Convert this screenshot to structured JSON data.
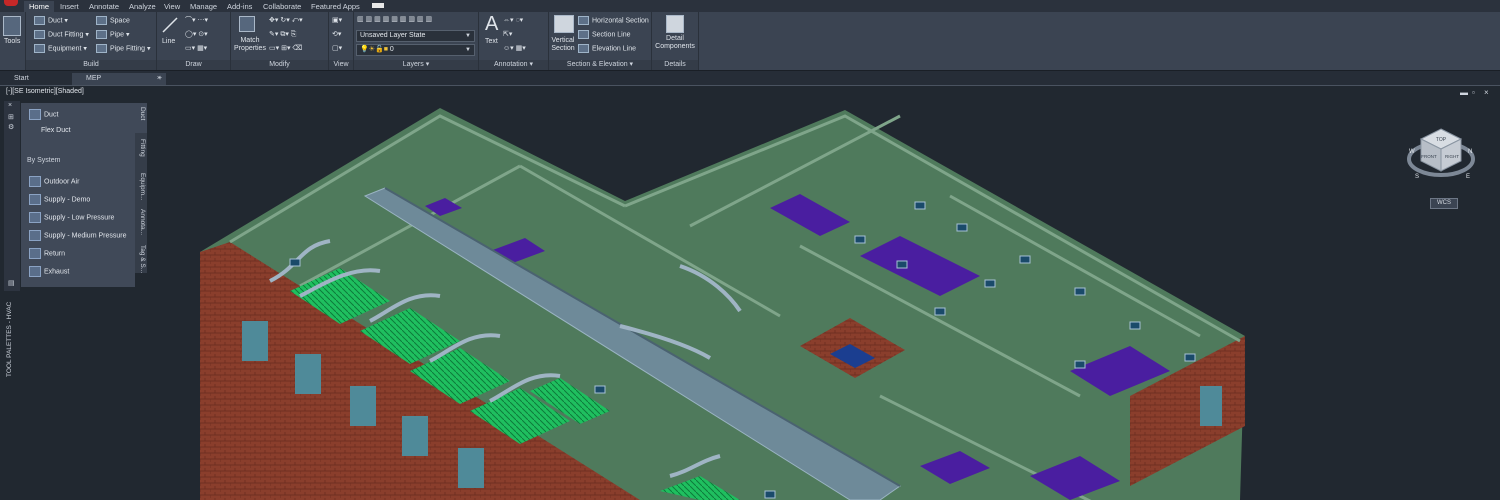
{
  "ribbon_tabs": [
    "Home",
    "Insert",
    "Annotate",
    "Analyze",
    "View",
    "Manage",
    "Add-ins",
    "Collaborate",
    "Featured Apps"
  ],
  "panels": {
    "tools": {
      "label": "Tools"
    },
    "build": {
      "title": "Build",
      "duct": "Duct",
      "duct_fitting": "Duct Fitting",
      "equipment": "Equipment",
      "space": "Space",
      "pipe": "Pipe",
      "pipe_fitting": "Pipe Fitting"
    },
    "draw": {
      "title": "Draw",
      "line": "Line"
    },
    "modify": {
      "title": "Modify",
      "match_properties": "Match Properties"
    },
    "view": {
      "title": "View"
    },
    "layers": {
      "title": "Layers",
      "layer_state": "Unsaved Layer State",
      "current_layer": "0"
    },
    "annotation": {
      "title": "Annotation",
      "text": "Text"
    },
    "section": {
      "title": "Section & Elevation",
      "vertical_section": "Vertical Section",
      "horizontal_section": "Horizontal Section",
      "section_line": "Section Line",
      "elevation_line": "Elevation Line"
    },
    "details": {
      "title": "Details",
      "detail_components": "Detail Components"
    }
  },
  "doc_tabs": [
    "Start",
    "MEP"
  ],
  "viewport_label": "[-][SE Isometric][Shaded]",
  "palette": {
    "title": "TOOL PALETTES - HVAC",
    "items_top": [
      "Duct",
      "Flex Duct"
    ],
    "section": "By System",
    "items_system": [
      "Outdoor Air",
      "Supply - Demo",
      "Supply - Low Pressure",
      "Supply - Medium Pressure",
      "Return",
      "Exhaust"
    ],
    "tabs": [
      "Duct",
      "Fitting",
      "Equipm...",
      "Annota...",
      "Tag & S..."
    ]
  },
  "viewcube": {
    "top": "TOP",
    "front": "FRONT",
    "right": "RIGHT",
    "compass": [
      "N",
      "W",
      "S",
      "E"
    ],
    "wcs": "WCS"
  },
  "colors": {
    "ribbon": "#3b4452",
    "canvas": "#212830",
    "brick": "#8a3e2c",
    "wall_green": "#4f7a5c",
    "floor_purple": "#4a1ea0",
    "duct": "#6e8a99",
    "grille": "#22cc66"
  }
}
